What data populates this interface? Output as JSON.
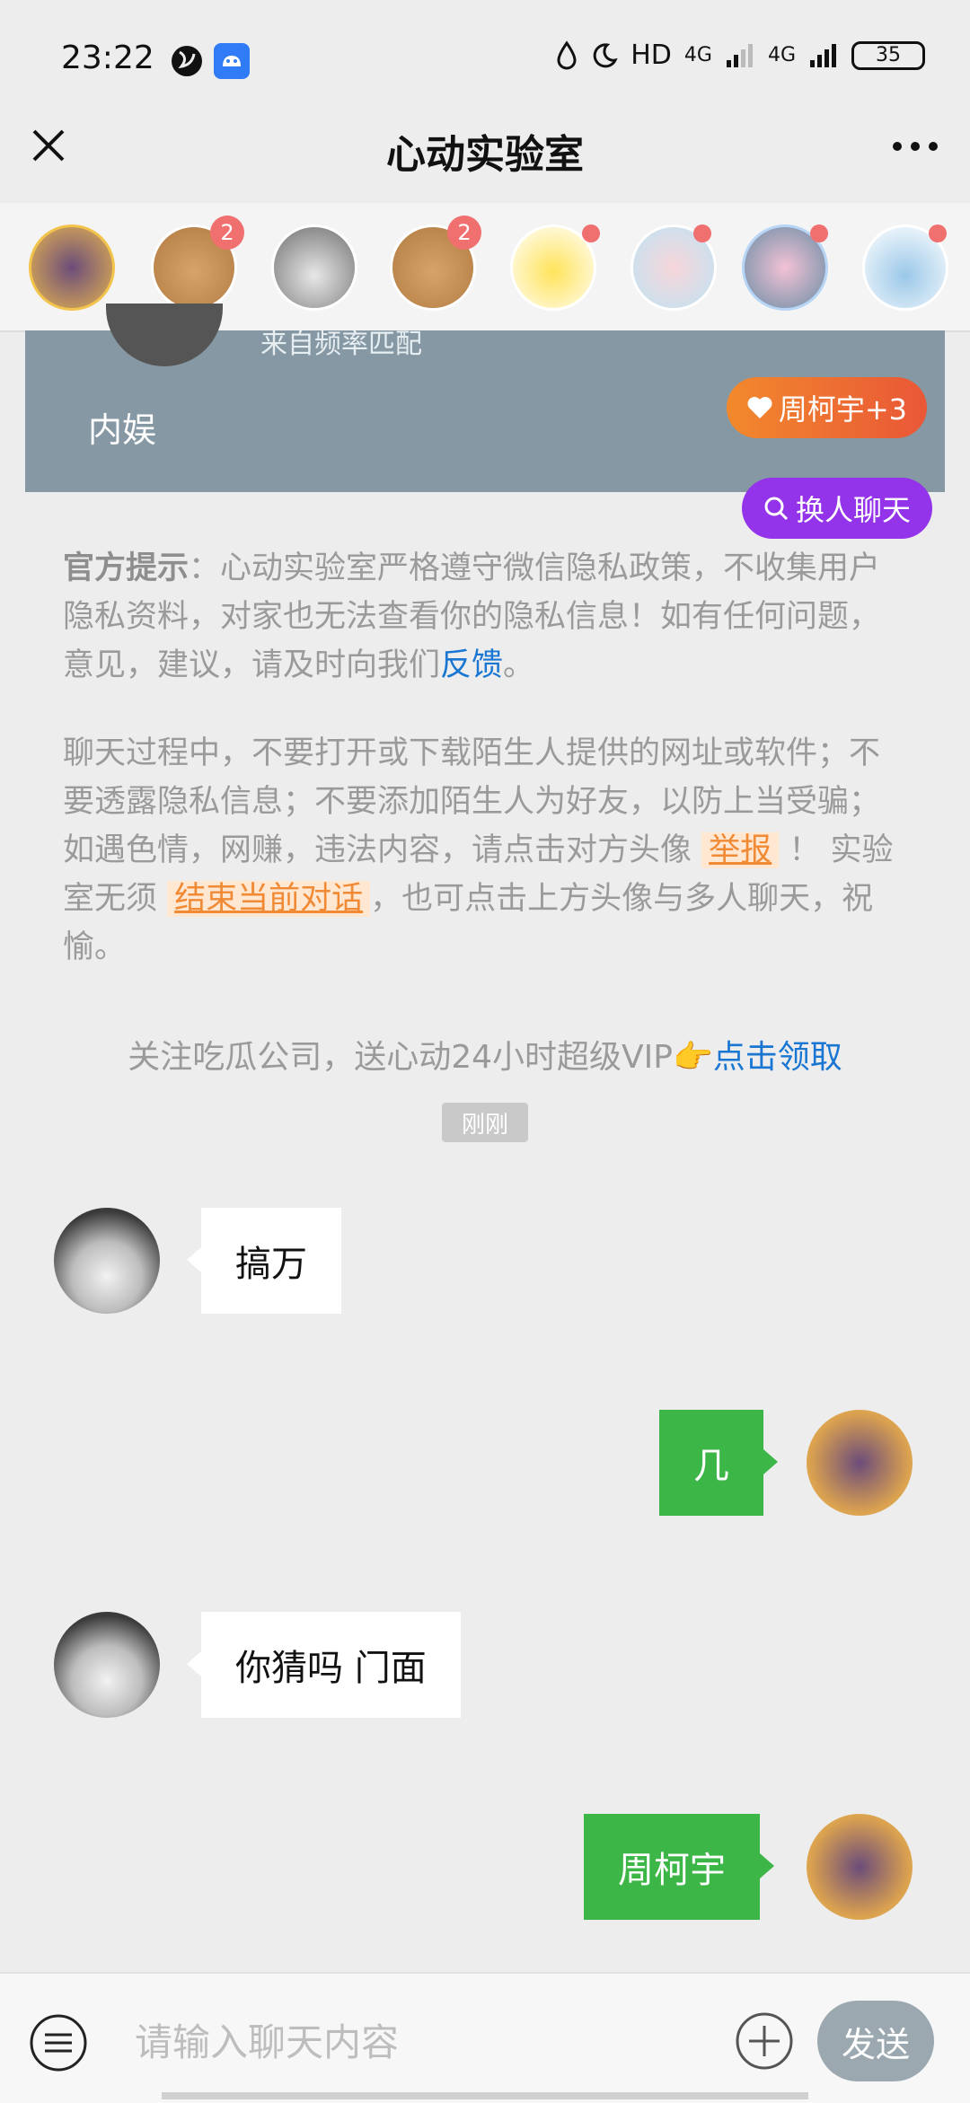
{
  "status_bar": {
    "time": "23:22",
    "network": "HD",
    "signal1": "4G",
    "signal2": "4G",
    "battery": "35"
  },
  "header": {
    "title": "心动实验室"
  },
  "avatar_strip": {
    "badges": [
      "2",
      "2"
    ]
  },
  "card": {
    "subtitle": "来自频率匹配",
    "tag": "内娱",
    "heart_label": "周柯宇+3",
    "switch_label": "换人聊天"
  },
  "notice1": {
    "prefix": "官方提示",
    "text": "：心动实验室严格遵守微信隐私政策，不收集用户隐私资料，对家也无法查看你的隐私信息！如有任何问题，意见，建议，请及时向我们",
    "link": "反馈",
    "suffix": "。"
  },
  "notice2": {
    "text1": "聊天过程中，不要打开或下载陌生人提供的网址或软件；不要透露隐私信息；不要添加陌生人为好友，以防上当受骗；如遇色情，网赚，违法内容，请点击对方头像",
    "report": "举报",
    "text2": "！ 实验室无须",
    "end_chat": "结束当前对话",
    "text3": "，也可点击上方头像与多人聊天，祝愉。"
  },
  "promo": {
    "text": "关注吃瓜公司，送心动24小时超级VIP👉",
    "link": "点击领取"
  },
  "time_badge": "刚刚",
  "messages": [
    {
      "side": "in",
      "text": "搞万"
    },
    {
      "side": "out",
      "text": "几"
    },
    {
      "side": "in",
      "text": "你猜吗 门面"
    },
    {
      "side": "out",
      "text": "周柯宇"
    }
  ],
  "input": {
    "placeholder": "请输入聊天内容",
    "send_label": "发送"
  },
  "colors": {
    "accent_green": "#3DB648",
    "switch_purple": "#9333EA",
    "link_blue": "#1976D2",
    "warn_orange": "#F08A35"
  }
}
